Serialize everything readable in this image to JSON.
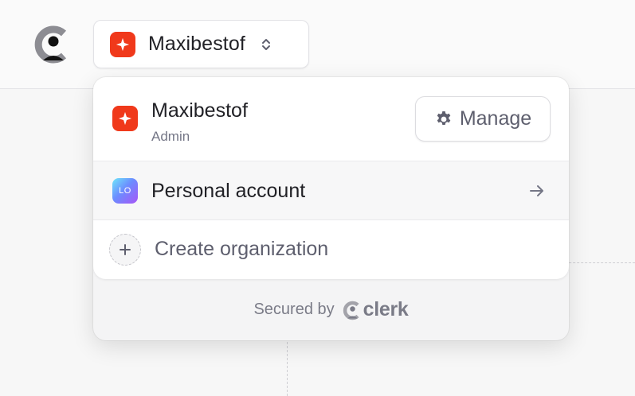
{
  "switcher": {
    "selected_name": "Maxibestof"
  },
  "popover": {
    "active_org": {
      "name": "Maxibestof",
      "role": "Admin",
      "manage_label": "Manage"
    },
    "personal_account": {
      "avatar_initials": "LO",
      "label": "Personal account"
    },
    "create_org": {
      "label": "Create organization"
    },
    "footer": {
      "secured_label": "Secured by",
      "brand": "clerk"
    }
  },
  "icons": {
    "app_logo": "clerk-logo-icon",
    "org_logo": "sparkle-icon",
    "switcher_toggle": "chevron-up-down-icon",
    "manage": "gear-icon",
    "personal_go": "arrow-right-icon",
    "create": "plus-icon"
  },
  "colors": {
    "org_badge": "#f0391b",
    "text_primary": "#212126",
    "text_secondary": "#747686",
    "muted": "#7a7b87"
  }
}
